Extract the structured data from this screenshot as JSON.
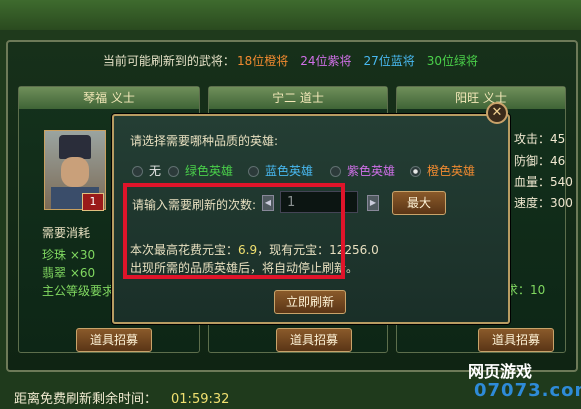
{
  "info_bar": {
    "prefix": "当前可能刷新到的武将：",
    "orange": "18位橙将",
    "purple": "24位紫将",
    "blue": "27位蓝将",
    "green": "30位绿将"
  },
  "cards": [
    {
      "name": "琴福   义士"
    },
    {
      "name": "宁二   道士"
    },
    {
      "name": "阳旺   义士"
    }
  ],
  "hero_level": "1",
  "cost": {
    "label": "需要消耗",
    "pearl": "珍珠  ×30",
    "jade": "翡翠  ×60",
    "master_req": "主公等级要求"
  },
  "stats": {
    "attack": "攻击：45",
    "defense": "防御：46",
    "hp": "血量：540",
    "speed": "速度：300",
    "partial": "求：10"
  },
  "buttons": {
    "recruit": "道具招募",
    "refresh_now": "立即刷新",
    "max": "最大"
  },
  "timer": {
    "label": "距离免费刷新剩余时间：",
    "value": "01:59:32"
  },
  "dialog": {
    "quality_prompt": "请选择需要哪种品质的英雄:",
    "options": [
      {
        "label": "无",
        "color": "#e8e8e8",
        "selected": false
      },
      {
        "label": "绿色英雄",
        "color": "#4ad04a",
        "selected": false
      },
      {
        "label": "蓝色英雄",
        "color": "#48b8f0",
        "selected": false
      },
      {
        "label": "紫色英雄",
        "color": "#d070e8",
        "selected": false
      },
      {
        "label": "橙色英雄",
        "color": "#f08a30",
        "selected": true
      }
    ],
    "count_prompt": "请输入需要刷新的次数:",
    "count_value": "1",
    "cost_line_prefix": "本次最高花费元宝：",
    "cost_value": "6.9",
    "have_prefix": "，现有元宝：",
    "have_value": "12256.0",
    "note": "出现所需的品质英雄后，将自动停止刷新。"
  },
  "watermark": {
    "line1": "网页游戏",
    "line2": "07073.com"
  }
}
